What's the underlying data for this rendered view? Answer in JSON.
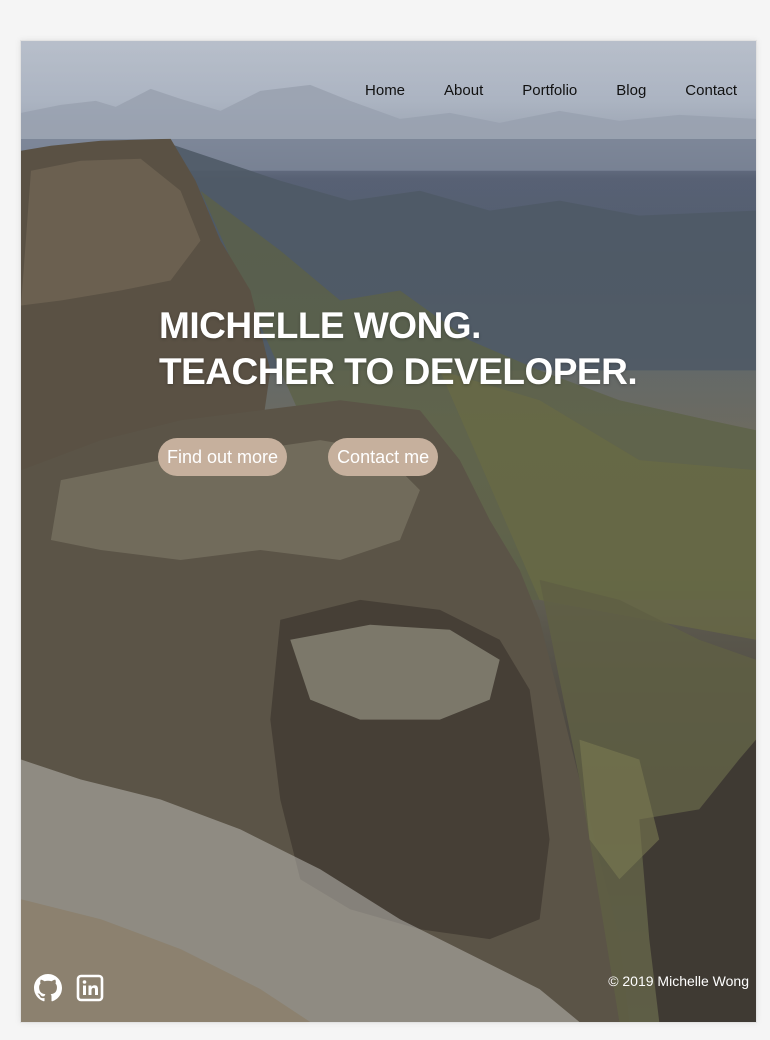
{
  "nav": {
    "items": [
      {
        "label": "Home"
      },
      {
        "label": "About"
      },
      {
        "label": "Portfolio"
      },
      {
        "label": "Blog"
      },
      {
        "label": "Contact"
      }
    ]
  },
  "hero": {
    "title_line1": "MICHELLE WONG.",
    "title_line2": "TEACHER TO DEVELOPER.",
    "buttons": {
      "find_out_more": "Find out more",
      "contact_me": "Contact me"
    },
    "background_image": "mountain-landscape"
  },
  "footer": {
    "copyright": "© 2019 Michelle Wong",
    "social": [
      {
        "icon": "github-icon"
      },
      {
        "icon": "linkedin-icon"
      }
    ]
  },
  "colors": {
    "button_bg": "#c6b09d",
    "headline": "#ffffff",
    "nav_text": "#111111",
    "page_bg": "#f5f5f5"
  }
}
